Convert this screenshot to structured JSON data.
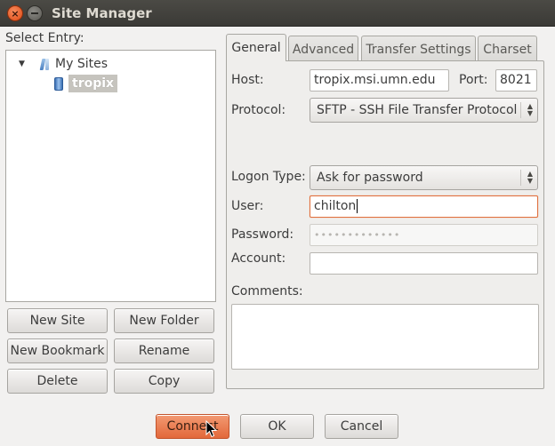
{
  "window": {
    "title": "Site Manager"
  },
  "left": {
    "select_entry_label": "Select Entry:",
    "tree": {
      "root": {
        "label": "My Sites",
        "expanded": true
      },
      "sites": [
        {
          "label": "tropix",
          "selected": true
        }
      ]
    },
    "buttons": {
      "new_site": "New Site",
      "new_folder": "New Folder",
      "new_bookmark": "New Bookmark",
      "rename": "Rename",
      "delete": "Delete",
      "copy": "Copy"
    }
  },
  "tabs": [
    {
      "label": "General",
      "active": true
    },
    {
      "label": "Advanced",
      "active": false
    },
    {
      "label": "Transfer Settings",
      "active": false
    },
    {
      "label": "Charset",
      "active": false
    }
  ],
  "general": {
    "host_label": "Host:",
    "host_value": "tropix.msi.umn.edu",
    "port_label": "Port:",
    "port_value": "8021",
    "protocol_label": "Protocol:",
    "protocol_value": "SFTP - SSH File Transfer Protocol",
    "logon_type_label": "Logon Type:",
    "logon_type_value": "Ask for password",
    "user_label": "User:",
    "user_value": "chilton",
    "password_label": "Password:",
    "password_value": "•••••••••••••",
    "account_label": "Account:",
    "account_value": "",
    "comments_label": "Comments:",
    "comments_value": ""
  },
  "footer": {
    "connect": "Connect",
    "ok": "OK",
    "cancel": "Cancel"
  },
  "colors": {
    "accent": "#e2683a",
    "titlebar": "#3c3b37",
    "background": "#f2f1f0"
  }
}
